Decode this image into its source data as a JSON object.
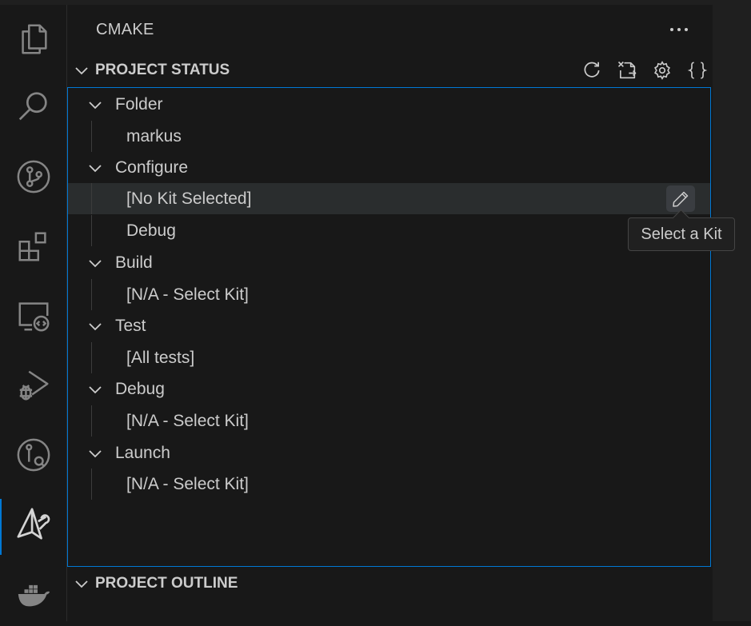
{
  "activity_bar": {
    "items": [
      {
        "name": "explorer-icon",
        "active": false
      },
      {
        "name": "search-icon",
        "active": false
      },
      {
        "name": "source-control-icon",
        "active": false
      },
      {
        "name": "extensions-icon",
        "active": false
      },
      {
        "name": "remote-explorer-icon",
        "active": false
      },
      {
        "name": "run-and-debug-icon",
        "active": false
      },
      {
        "name": "gitlens-icon",
        "active": false
      },
      {
        "name": "cmake-icon",
        "active": true
      },
      {
        "name": "docker-icon",
        "active": false
      }
    ]
  },
  "sidebar": {
    "title": "CMAKE",
    "more_actions_icon": "ellipsis-icon"
  },
  "project_status": {
    "title": "PROJECT STATUS",
    "actions": [
      "refresh-icon",
      "delete-cache-icon",
      "settings-icon",
      "json-braces-icon"
    ],
    "groups": [
      {
        "label": "Folder",
        "children": [
          "markus"
        ]
      },
      {
        "label": "Configure",
        "children": [
          "[No Kit Selected]",
          "Debug"
        ]
      },
      {
        "label": "Build",
        "children": [
          "[N/A - Select Kit]"
        ]
      },
      {
        "label": "Test",
        "children": [
          "[All tests]"
        ]
      },
      {
        "label": "Debug",
        "children": [
          "[N/A - Select Kit]"
        ]
      },
      {
        "label": "Launch",
        "children": [
          "[N/A - Select Kit]"
        ]
      }
    ]
  },
  "tooltip": {
    "text": "Select a Kit"
  },
  "project_outline": {
    "title": "PROJECT OUTLINE"
  },
  "colors": {
    "background": "#181818",
    "focus_border": "#0078d4",
    "hover_row": "#2a2d2e",
    "text": "#cccccc"
  }
}
